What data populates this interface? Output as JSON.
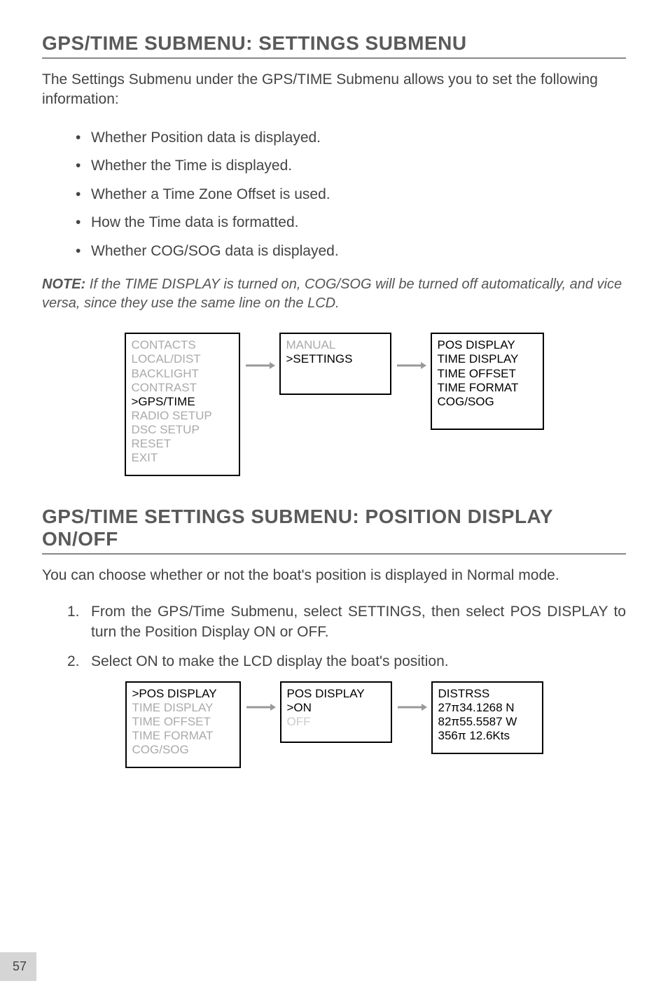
{
  "section1": {
    "heading": "GPS/TIME SUBMENU: SETTINGS SUBMENU",
    "intro": "The Settings Submenu under the GPS/TIME Submenu allows you to set the following information:",
    "bullets": [
      "Whether Position data is displayed.",
      "Whether the Time is displayed.",
      "Whether a Time Zone Offset is used.",
      "How the Time data is formatted.",
      "Whether COG/SOG data is displayed."
    ],
    "noteLabel": "NOTE:",
    "noteText": " If the TIME DISPLAY is turned on, COG/SOG will be turned off automatically, and vice versa, since they use the same line on the LCD."
  },
  "diag1": {
    "box1": {
      "l1": "CONTACTS",
      "l2": "LOCAL/DIST",
      "l3": "BACKLIGHT",
      "l4": "CONTRAST",
      "l5": ">GPS/TIME",
      "l6": "RADIO SETUP",
      "l7": "DSC SETUP",
      "l8": "RESET",
      "l9": "EXIT"
    },
    "box2": {
      "l1": "MANUAL",
      "l2": ">SETTINGS"
    },
    "box3": {
      "l1": "POS DISPLAY",
      "l2": "TIME DISPLAY",
      "l3": "TIME OFFSET",
      "l4": "TIME FORMAT",
      "l5": "COG/SOG"
    }
  },
  "section2": {
    "heading": "GPS/TIME SETTINGS SUBMENU: POSITION DISPLAY ON/OFF",
    "intro": "You can choose whether or not the boat's position is displayed in Normal mode.",
    "ol": [
      "From the GPS/Time Submenu, select SETTINGS, then select POS DISPLAY to turn the Position Display ON or OFF.",
      "Select ON to make the LCD display the boat's position."
    ]
  },
  "diag2": {
    "box1": {
      "l1": ">POS DISPLAY",
      "l2": "TIME DISPLAY",
      "l3": "TIME OFFSET",
      "l4": "TIME FORMAT",
      "l5": "COG/SOG"
    },
    "box2": {
      "l1": " POS DISPLAY",
      "l2": ">ON",
      "l3": " OFF"
    },
    "box3": {
      "l1": "DISTRSS",
      "l2": " 27π34.1268 N",
      "l3": " 82π55.5587 W",
      "l4": "356π  12.6Kts"
    }
  },
  "pageNum": "57"
}
